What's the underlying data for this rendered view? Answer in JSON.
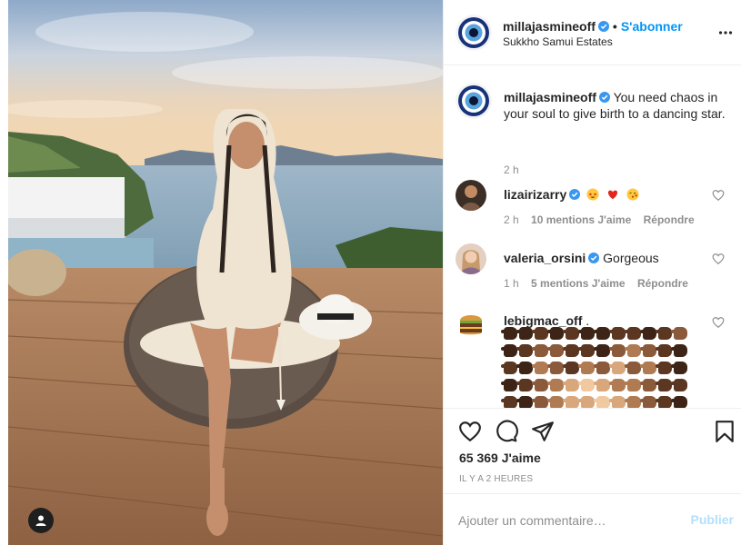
{
  "post": {
    "author": {
      "username": "millajasmineoff",
      "verified": true,
      "follow_label": "S'abonner",
      "location": "Sukkho Samui Estates",
      "avatar_icon": "evil-eye-avatar"
    },
    "caption": {
      "username": "millajasmineoff",
      "text": "You need chaos in your soul to give birth to a dancing star.",
      "time": "2 h"
    },
    "comments": [
      {
        "username": "lizairizarry",
        "verified": true,
        "text": "",
        "emojis": [
          "star-struck-emoji",
          "red-heart-emoji",
          "kissing-heart-emoji"
        ],
        "time": "2 h",
        "likes": "10 mentions J'aime",
        "reply": "Répondre"
      },
      {
        "username": "valeria_orsini",
        "verified": true,
        "text": "Gorgeous",
        "time": "1 h",
        "likes": "5 mentions J'aime",
        "reply": "Répondre"
      },
      {
        "username": "lebigmac_off",
        "verified": false,
        "text": ".",
        "emojis": [
          "hand-emoji-rows"
        ]
      }
    ],
    "likes_count": "65 369",
    "likes_suffix": "J'aime",
    "time_ago": "IL Y A 2 HEURES",
    "comment_placeholder": "Ajouter un commentaire…",
    "publish_label": "Publier"
  },
  "colors": {
    "accent_blue": "#0095f6",
    "publish_disabled": "#b2dffc",
    "muted": "#8e8e8e",
    "border": "#efefef",
    "text": "#262626"
  },
  "icons": [
    "more-options-icon",
    "heart-icon",
    "comment-icon",
    "share-icon",
    "bookmark-icon",
    "user-tag-icon",
    "verified-badge-icon"
  ]
}
